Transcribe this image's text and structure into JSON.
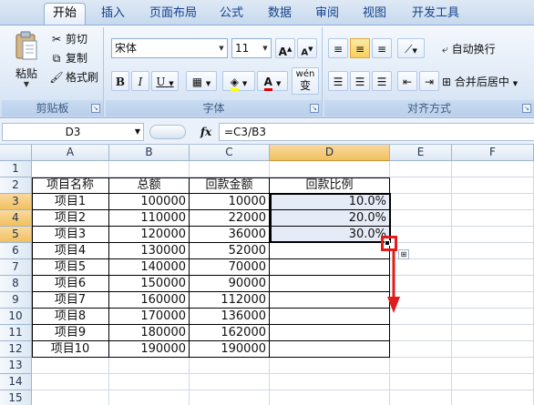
{
  "tabs": [
    "开始",
    "插入",
    "页面布局",
    "公式",
    "数据",
    "审阅",
    "视图",
    "开发工具"
  ],
  "clipboard": {
    "paste": "粘贴",
    "cut": "剪切",
    "copy": "复制",
    "format_painter": "格式刷",
    "title": "剪贴板"
  },
  "font": {
    "name": "宋体",
    "size": "11",
    "title": "字体",
    "bold": "B",
    "italic": "I",
    "underline": "U",
    "grow": "A",
    "shrink": "A",
    "color_letter": "A",
    "wen": "wén",
    "wen_char": "变"
  },
  "alignment": {
    "wrap_text": "自动换行",
    "merge_center": "合并后居中",
    "title": "对齐方式"
  },
  "formula_bar": {
    "name_box": "D3",
    "fx": "fx",
    "formula": "=C3/B3"
  },
  "columns": [
    "A",
    "B",
    "C",
    "D",
    "E",
    "F"
  ],
  "rows": [
    "1",
    "2",
    "3",
    "4",
    "5",
    "6",
    "7",
    "8",
    "9",
    "10",
    "11",
    "12",
    "13",
    "14",
    "15"
  ],
  "sheet": {
    "headers": [
      "项目名称",
      "总额",
      "回款金额",
      "回款比例"
    ],
    "data": [
      [
        "项目1",
        "100000",
        "10000",
        "10.0%"
      ],
      [
        "项目2",
        "110000",
        "22000",
        "20.0%"
      ],
      [
        "项目3",
        "120000",
        "36000",
        "30.0%"
      ],
      [
        "项目4",
        "130000",
        "52000",
        ""
      ],
      [
        "项目5",
        "140000",
        "70000",
        ""
      ],
      [
        "项目6",
        "150000",
        "90000",
        ""
      ],
      [
        "项目7",
        "160000",
        "112000",
        ""
      ],
      [
        "项目8",
        "170000",
        "136000",
        ""
      ],
      [
        "项目9",
        "180000",
        "162000",
        ""
      ],
      [
        "项目10",
        "190000",
        "190000",
        ""
      ]
    ]
  },
  "colors": {
    "annotation": "#e21b1b",
    "selected_header": "#f1c15f",
    "ribbon": "#dfe9f5"
  }
}
